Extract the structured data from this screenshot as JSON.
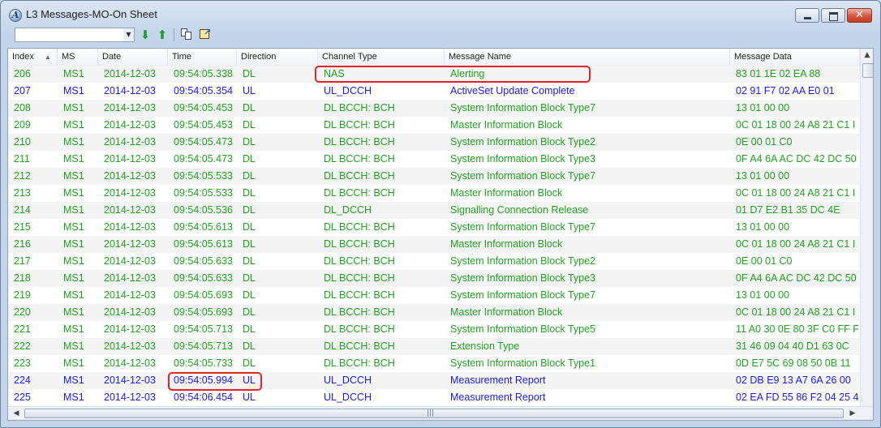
{
  "window": {
    "title": "L3 Messages-MO-On Sheet"
  },
  "toolbar": {
    "filter_value": "",
    "icons": [
      "arrow-down-icon",
      "arrow-up-icon",
      "copy-icon",
      "export-icon"
    ]
  },
  "colors": {
    "downlink_text": "#1fa31f",
    "uplink_text": "#1a1aee",
    "highlight_border": "#e8222a"
  },
  "columns": [
    "Index",
    "MS",
    "Date",
    "Time",
    "Direction",
    "Channel Type",
    "Message Name",
    "Message Data"
  ],
  "sort": {
    "column": "Index",
    "order": "ascending"
  },
  "rows": [
    {
      "index": "206",
      "ms": "MS1",
      "date": "2014-12-03",
      "time": "09:54:05.338",
      "direction": "DL",
      "channel": "NAS",
      "message": "Alerting",
      "data": "83 01 1E 02 EA 88"
    },
    {
      "index": "207",
      "ms": "MS1",
      "date": "2014-12-03",
      "time": "09:54:05.354",
      "direction": "UL",
      "channel": "UL_DCCH",
      "message": "ActiveSet Update Complete",
      "data": "02 91 F7 02 AA E0 01"
    },
    {
      "index": "208",
      "ms": "MS1",
      "date": "2014-12-03",
      "time": "09:54:05.453",
      "direction": "DL",
      "channel": "DL BCCH: BCH",
      "message": "System Information Block Type7",
      "data": "13 01 00 00"
    },
    {
      "index": "209",
      "ms": "MS1",
      "date": "2014-12-03",
      "time": "09:54:05.453",
      "direction": "DL",
      "channel": "DL BCCH: BCH",
      "message": "Master Information Block",
      "data": "0C 01 18 00 24 A8 21 C1 I"
    },
    {
      "index": "210",
      "ms": "MS1",
      "date": "2014-12-03",
      "time": "09:54:05.473",
      "direction": "DL",
      "channel": "DL BCCH: BCH",
      "message": "System Information Block Type2",
      "data": "0E 00 01 C0"
    },
    {
      "index": "211",
      "ms": "MS1",
      "date": "2014-12-03",
      "time": "09:54:05.473",
      "direction": "DL",
      "channel": "DL BCCH: BCH",
      "message": "System Information Block Type3",
      "data": "0F A4 6A AC DC 42 DC 50"
    },
    {
      "index": "212",
      "ms": "MS1",
      "date": "2014-12-03",
      "time": "09:54:05.533",
      "direction": "DL",
      "channel": "DL BCCH: BCH",
      "message": "System Information Block Type7",
      "data": "13 01 00 00"
    },
    {
      "index": "213",
      "ms": "MS1",
      "date": "2014-12-03",
      "time": "09:54:05.533",
      "direction": "DL",
      "channel": "DL BCCH: BCH",
      "message": "Master Information Block",
      "data": "0C 01 18 00 24 A8 21 C1 I"
    },
    {
      "index": "214",
      "ms": "MS1",
      "date": "2014-12-03",
      "time": "09:54:05.536",
      "direction": "DL",
      "channel": "DL_DCCH",
      "message": "Signalling Connection Release",
      "data": "01 D7 E2 B1 35 DC 4E"
    },
    {
      "index": "215",
      "ms": "MS1",
      "date": "2014-12-03",
      "time": "09:54:05.613",
      "direction": "DL",
      "channel": "DL BCCH: BCH",
      "message": "System Information Block Type7",
      "data": "13 01 00 00"
    },
    {
      "index": "216",
      "ms": "MS1",
      "date": "2014-12-03",
      "time": "09:54:05.613",
      "direction": "DL",
      "channel": "DL BCCH: BCH",
      "message": "Master Information Block",
      "data": "0C 01 18 00 24 A8 21 C1 I"
    },
    {
      "index": "217",
      "ms": "MS1",
      "date": "2014-12-03",
      "time": "09:54:05.633",
      "direction": "DL",
      "channel": "DL BCCH: BCH",
      "message": "System Information Block Type2",
      "data": "0E 00 01 C0"
    },
    {
      "index": "218",
      "ms": "MS1",
      "date": "2014-12-03",
      "time": "09:54:05.633",
      "direction": "DL",
      "channel": "DL BCCH: BCH",
      "message": "System Information Block Type3",
      "data": "0F A4 6A AC DC 42 DC 50"
    },
    {
      "index": "219",
      "ms": "MS1",
      "date": "2014-12-03",
      "time": "09:54:05.693",
      "direction": "DL",
      "channel": "DL BCCH: BCH",
      "message": "System Information Block Type7",
      "data": "13 01 00 00"
    },
    {
      "index": "220",
      "ms": "MS1",
      "date": "2014-12-03",
      "time": "09:54:05.693",
      "direction": "DL",
      "channel": "DL BCCH: BCH",
      "message": "Master Information Block",
      "data": "0C 01 18 00 24 A8 21 C1 I"
    },
    {
      "index": "221",
      "ms": "MS1",
      "date": "2014-12-03",
      "time": "09:54:05.713",
      "direction": "DL",
      "channel": "DL BCCH: BCH",
      "message": "System Information Block Type5",
      "data": "11 A0 30 0E 80 3F C0 FF F"
    },
    {
      "index": "222",
      "ms": "MS1",
      "date": "2014-12-03",
      "time": "09:54:05.713",
      "direction": "DL",
      "channel": "DL BCCH: BCH",
      "message": "Extension Type",
      "data": "31 46 09 04 40 D1 63 0C"
    },
    {
      "index": "223",
      "ms": "MS1",
      "date": "2014-12-03",
      "time": "09:54:05.733",
      "direction": "DL",
      "channel": "DL BCCH: BCH",
      "message": "System Information Block Type1",
      "data": "0D E7 5C 69 08 50 0B 11"
    },
    {
      "index": "224",
      "ms": "MS1",
      "date": "2014-12-03",
      "time": "09:54:05.994",
      "direction": "UL",
      "channel": "UL_DCCH",
      "message": "Measurement Report",
      "data": "02 DB E9 13 A7 6A 26 00"
    },
    {
      "index": "225",
      "ms": "MS1",
      "date": "2014-12-03",
      "time": "09:54:06.454",
      "direction": "UL",
      "channel": "UL_DCCH",
      "message": "Measurement Report",
      "data": "02 EA FD 55 86 F2 04 25 4"
    }
  ],
  "highlights": [
    {
      "row": "206",
      "columns": [
        "Channel Type",
        "Message Name"
      ]
    },
    {
      "row": "224",
      "columns": [
        "Time",
        "Direction"
      ]
    }
  ]
}
